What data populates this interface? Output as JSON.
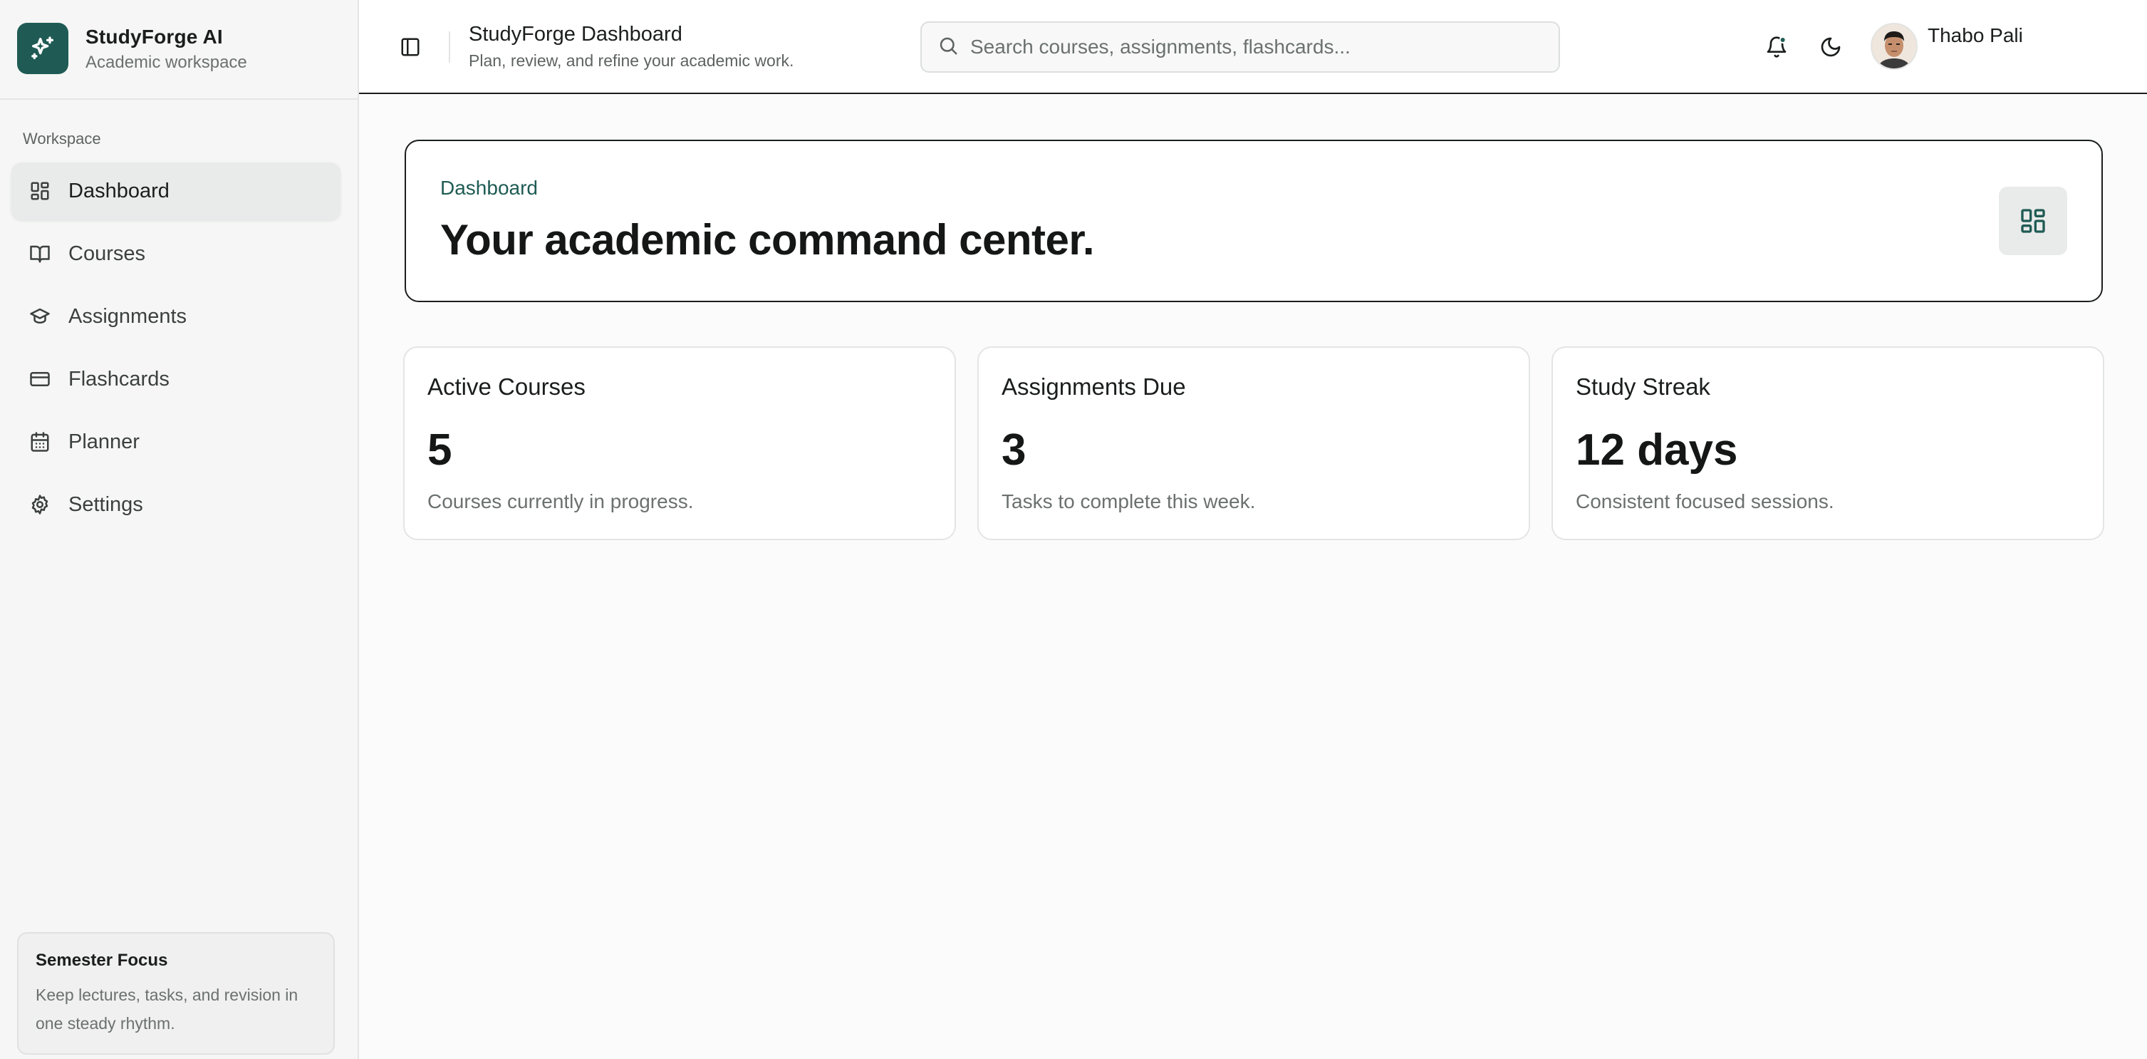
{
  "brand": {
    "name": "StudyForge AI",
    "subtitle": "Academic workspace"
  },
  "sidebar": {
    "section_label": "Workspace",
    "items": [
      {
        "label": "Dashboard",
        "icon": "layout-grid-icon",
        "active": true
      },
      {
        "label": "Courses",
        "icon": "book-icon",
        "active": false
      },
      {
        "label": "Assignments",
        "icon": "graduation-cap-icon",
        "active": false
      },
      {
        "label": "Flashcards",
        "icon": "card-icon",
        "active": false
      },
      {
        "label": "Planner",
        "icon": "calendar-icon",
        "active": false
      },
      {
        "label": "Settings",
        "icon": "gear-icon",
        "active": false
      }
    ],
    "focus_card": {
      "title": "Semester Focus",
      "text": "Keep lectures, tasks, and revision in one steady rhythm."
    }
  },
  "header": {
    "title": "StudyForge Dashboard",
    "subtitle": "Plan, review, and refine your academic work.",
    "search_placeholder": "Search courses, assignments, flashcards...",
    "user_name": "Thabo Pali",
    "notification_dot": true
  },
  "hero": {
    "eyebrow": "Dashboard",
    "title": "Your academic command center."
  },
  "stats": [
    {
      "title": "Active Courses",
      "value": "5",
      "desc": "Courses currently in progress."
    },
    {
      "title": "Assignments Due",
      "value": "3",
      "desc": "Tasks to complete this week."
    },
    {
      "title": "Study Streak",
      "value": "12 days",
      "desc": "Consistent focused sessions."
    }
  ],
  "colors": {
    "accent": "#1f5b54",
    "notification": "#1f5b54",
    "sidebar_bg": "#f5f6f5",
    "active_item_bg": "#e9ebea"
  }
}
